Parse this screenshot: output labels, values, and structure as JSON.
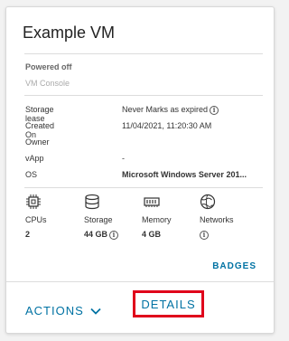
{
  "card": {
    "title": "Example VM",
    "status": "Powered off",
    "console_link": "VM Console"
  },
  "properties": [
    {
      "key": "Storage lease",
      "value": "Never Marks as expired",
      "info": true
    },
    {
      "key": "Created On",
      "value": "11/04/2021, 11:20:30 AM"
    },
    {
      "key": "Owner",
      "value": ""
    },
    {
      "key": "vApp",
      "value": "-"
    },
    {
      "key": "OS",
      "value": "Microsoft Windows Server 201...",
      "bold": true
    }
  ],
  "resources": {
    "cpus": {
      "label": "CPUs",
      "value": "2",
      "icon": "cpu-icon"
    },
    "storage": {
      "label": "Storage",
      "value": "44 GB",
      "icon": "storage-icon"
    },
    "memory": {
      "label": "Memory",
      "value": "4 GB",
      "icon": "memory-icon"
    },
    "networks": {
      "label": "Networks",
      "value": "",
      "icon": "network-icon"
    }
  },
  "links": {
    "badges": "BADGES",
    "actions": "ACTIONS",
    "details": "DETAILS"
  },
  "colors": {
    "link": "#0072a3",
    "highlight": "#e0001b"
  }
}
